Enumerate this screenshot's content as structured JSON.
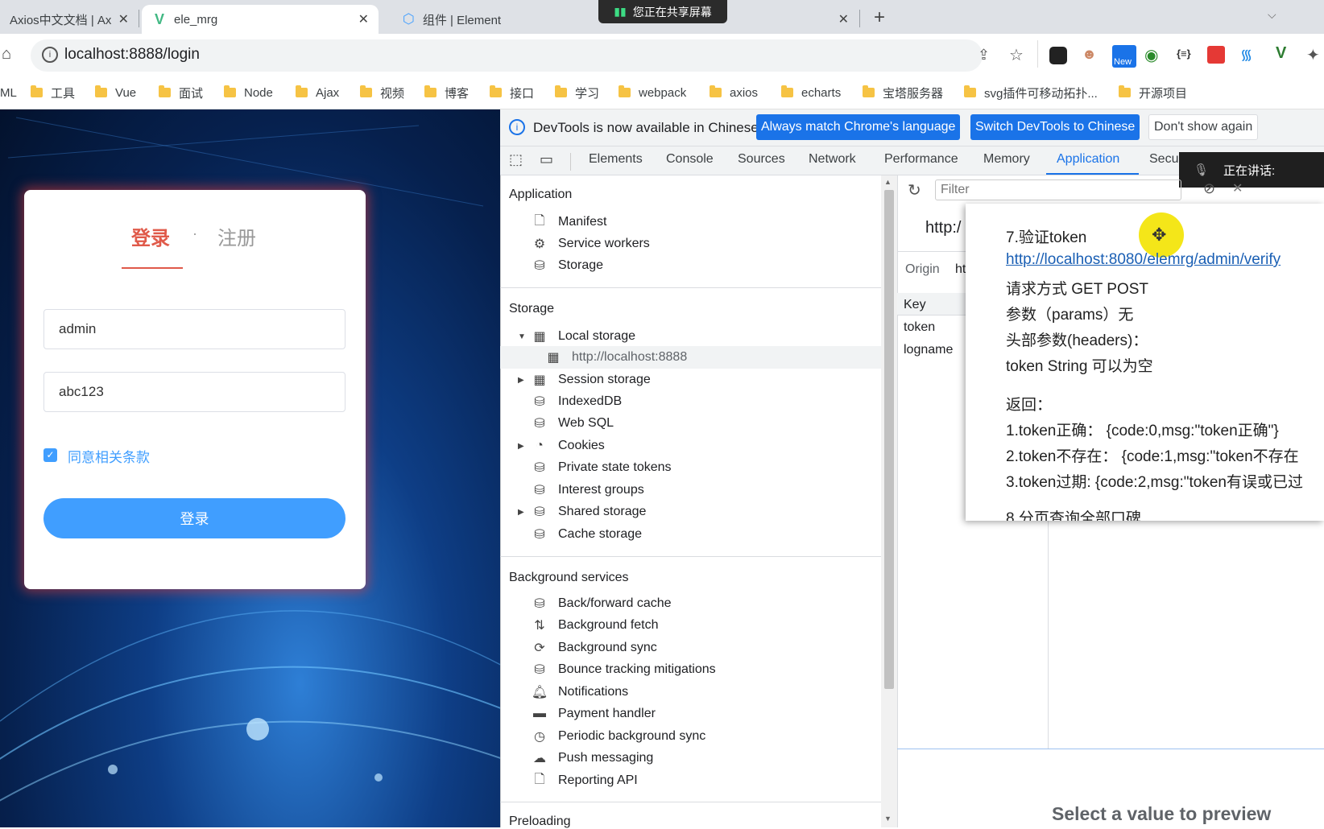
{
  "tabs": [
    {
      "label": "Axios中文文档 | Ax"
    },
    {
      "label": "ele_mrg"
    },
    {
      "label": "组件 | Element"
    }
  ],
  "share_label": "您正在共享屏幕",
  "address": {
    "url": "localhost:8888/login"
  },
  "extension_badge": "New",
  "bookmarks": [
    "ML",
    "工具",
    "Vue",
    "面试",
    "Node",
    "Ajax",
    "视频",
    "博客",
    "接口",
    "学习",
    "webpack",
    "axios",
    "echarts",
    "宝塔服务器",
    "svg插件可移动拓扑...",
    "开源项目"
  ],
  "login": {
    "tab_login": "登录",
    "dot": "·",
    "tab_register": "注册",
    "username": "admin",
    "password": "abc123",
    "agree_label": "同意相关条款",
    "submit_label": "登录",
    "colors": {
      "accent": "#e05a4a",
      "button": "#409eff"
    }
  },
  "devtools": {
    "info_text": "DevTools is now available in Chinese!",
    "btn_match": "Always match Chrome's language",
    "btn_switch": "Switch DevTools to Chinese",
    "btn_dismiss": "Don't show again",
    "tabs": [
      "Elements",
      "Console",
      "Sources",
      "Network",
      "Performance",
      "Memory",
      "Application",
      "Secu"
    ],
    "speaking": "正在讲话:",
    "filter_placeholder": "Filter",
    "sections": {
      "application": "Application",
      "storage": "Storage",
      "background": "Background services",
      "preloading": "Preloading"
    },
    "app_items": [
      "Manifest",
      "Service workers",
      "Storage"
    ],
    "storage_items": {
      "local": "Local storage",
      "local_origin": "http://localhost:8888",
      "session": "Session storage",
      "indexeddb": "IndexedDB",
      "websql": "Web SQL",
      "cookies": "Cookies",
      "private": "Private state tokens",
      "interest": "Interest groups",
      "shared": "Shared storage",
      "cache": "Cache storage"
    },
    "bg_items": [
      "Back/forward cache",
      "Background fetch",
      "Background sync",
      "Bounce tracking mitigations",
      "Notifications",
      "Payment handler",
      "Periodic background sync",
      "Push messaging",
      "Reporting API"
    ],
    "url_partial": "http:/",
    "origin_label": "Origin",
    "origin_value": "ht",
    "key_header": "Key",
    "keys": [
      "token",
      "logname"
    ],
    "preview": "Select a value to preview"
  },
  "note": {
    "title": "7.验证token",
    "link": "http://localhost:8080/elemrg/admin/verify",
    "method": "请求方式  GET POST",
    "params": "参数（params）无",
    "headers": "头部参数(headers)：",
    "token_line": "token  String   可以为空",
    "return_label": "返回：",
    "r1": "1.token正确：  {code:0,msg:\"token正确\"}",
    "r2": "2.token不存在：  {code:1,msg:\"token不存在",
    "r3": "3.token过期:  {code:2,msg:\"token有误或已过",
    "next": "8.分页查询全部口碑"
  }
}
